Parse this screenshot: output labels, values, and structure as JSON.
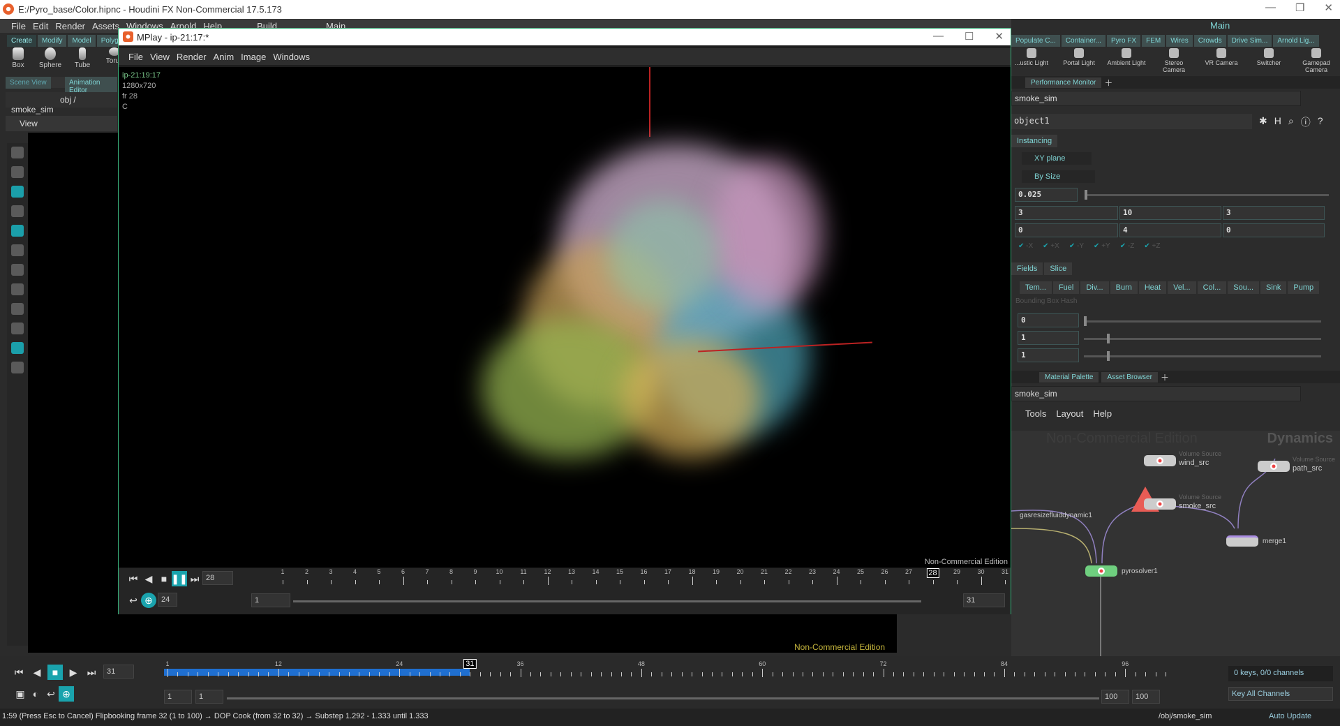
{
  "window": {
    "title": "E:/Pyro_base/Color.hipnc - Houdini FX Non-Commercial 17.5.173"
  },
  "main_menu": [
    "File",
    "Edit",
    "Render",
    "Assets",
    "Windows",
    "Arnold",
    "Help"
  ],
  "desktops": [
    "Build",
    "Main"
  ],
  "shelf": {
    "tabs": [
      "Create",
      "Modify",
      "Model",
      "Polygon"
    ],
    "tools": [
      "Box",
      "Sphere",
      "Tube",
      "Torus"
    ]
  },
  "left_pane": {
    "tabs": [
      "Scene View",
      "Animation Editor"
    ],
    "path": [
      "obj",
      "smoke_sim"
    ],
    "view_label": "View"
  },
  "mplay": {
    "title": "MPlay - ip-21:17:*",
    "menu": [
      "File",
      "View",
      "Render",
      "Anim",
      "Image",
      "Windows"
    ],
    "info": {
      "name": "ip-21:19:17",
      "res": "1280x720",
      "frame": "fr 28",
      "channel": "C"
    },
    "watermark": "Non-Commercial Edition",
    "frame": "28",
    "fps": "24",
    "range_start": "1",
    "range_end": "31",
    "ruler": {
      "start": 1,
      "end": 31,
      "current": 28
    }
  },
  "main_viewport": {
    "watermark": "Non-Commercial Edition"
  },
  "right": {
    "desktop": "Main",
    "shelf_tabs": [
      "Populate C...",
      "Container...",
      "Pyro FX",
      "FEM",
      "Wires",
      "Crowds",
      "Drive Sim...",
      "Arnold Lig..."
    ],
    "tools": [
      "...ustic Light",
      "Portal Light",
      "Ambient Light",
      "Stereo Camera",
      "VR Camera",
      "Switcher",
      "Gamepad Camera"
    ],
    "param_tabs": [
      "Performance Monitor"
    ],
    "param_path": "smoke_sim",
    "node_name": "object1",
    "tab_instancing": "Instancing",
    "plane": "XY plane",
    "mode": "By Size",
    "size": "0.025",
    "row1": [
      "3",
      "10",
      "3"
    ],
    "row2": [
      "0",
      "4",
      "0"
    ],
    "checks": [
      "-X",
      "+X",
      "-Y",
      "+Y",
      "-Z",
      "+Z"
    ],
    "subtabs": [
      "Fields",
      "Slice"
    ],
    "field_tabs": [
      "Tem...",
      "Fuel",
      "Div...",
      "Burn",
      "Heat",
      "Vel...",
      "Col...",
      "Sou...",
      "Sink",
      "Pump"
    ],
    "bbox_label": "Bounding Box Hash",
    "bbox_values": [
      "0",
      "1",
      "1"
    ],
    "net_tabs": [
      "Material Palette",
      "Asset Browser"
    ],
    "net_path": "smoke_sim",
    "net_menu": [
      "Tools",
      "Layout",
      "Help"
    ],
    "net_watermark": "Non-Commercial Edition",
    "net_context": "Dynamics",
    "nodes": [
      {
        "name": "wind_src",
        "type": "Volume Source"
      },
      {
        "name": "path_src",
        "type": "Volume Source"
      },
      {
        "name": "smoke_src",
        "type": "Volume Source"
      },
      {
        "name": "gasresizefluiddynamic1",
        "type": ""
      },
      {
        "name": "merge1",
        "type": ""
      },
      {
        "name": "pyrosolver1",
        "type": ""
      }
    ]
  },
  "timeline": {
    "frame": "31",
    "start": "1",
    "end": "100",
    "range_start": "1",
    "range_start2": "1",
    "range_end": "100",
    "range_end2": "100",
    "ruler": {
      "start": 1,
      "end": 100,
      "current": 31,
      "labels": [
        1,
        12,
        24,
        36,
        48,
        60,
        72,
        84,
        96
      ]
    },
    "keys": "0 keys, 0/0 channels",
    "key_mode": "Key All Channels"
  },
  "status": {
    "text": "1:59 (Press Esc to Cancel) Flipbooking frame 32 (1 to 100) → DOP Cook (from 32 to 32) → Substep 1.292 - 1.333 until 1.333",
    "path": "/obj/smoke_sim",
    "update": "Auto Update"
  },
  "colors": {
    "accent": "#1aa3ad",
    "timeline_fill": "#1f6fd0",
    "node_solver": "#6fcf7f",
    "warning": "#e85c55"
  }
}
